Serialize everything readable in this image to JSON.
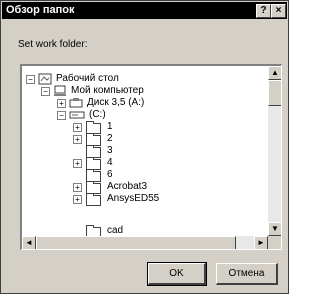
{
  "dialog": {
    "title": "Обзор папок",
    "help_button": "?",
    "close_button": "×",
    "prompt": "Set work folder:",
    "ok_label": "OK",
    "cancel_label": "Отмена"
  },
  "tree": {
    "items": [
      {
        "label": "Рабочий стол",
        "toggle": "−",
        "icon": "desktop-icon"
      },
      {
        "label": "Мой компьютер",
        "toggle": "−",
        "icon": "computer-icon"
      },
      {
        "label": "Диск 3,5 (A:)",
        "toggle": "+",
        "icon": "floppy-drive-icon"
      },
      {
        "label": "(C:)",
        "toggle": "−",
        "icon": "hard-drive-icon"
      },
      {
        "label": "1",
        "toggle": "+",
        "icon": "folder-icon"
      },
      {
        "label": "2",
        "toggle": "+",
        "icon": "folder-icon"
      },
      {
        "label": "3",
        "toggle": "",
        "icon": "folder-icon"
      },
      {
        "label": "4",
        "toggle": "+",
        "icon": "folder-icon"
      },
      {
        "label": "6",
        "toggle": "",
        "icon": "folder-icon"
      },
      {
        "label": "Acrobat3",
        "toggle": "+",
        "icon": "folder-icon"
      },
      {
        "label": "AnsysED55",
        "toggle": "+",
        "icon": "folder-icon"
      },
      {
        "label": "cad",
        "toggle": "",
        "icon": "folder-icon"
      }
    ]
  },
  "scrollbars": {
    "up_arrow": "▲",
    "down_arrow": "▼",
    "left_arrow": "◄",
    "right_arrow": "►"
  }
}
